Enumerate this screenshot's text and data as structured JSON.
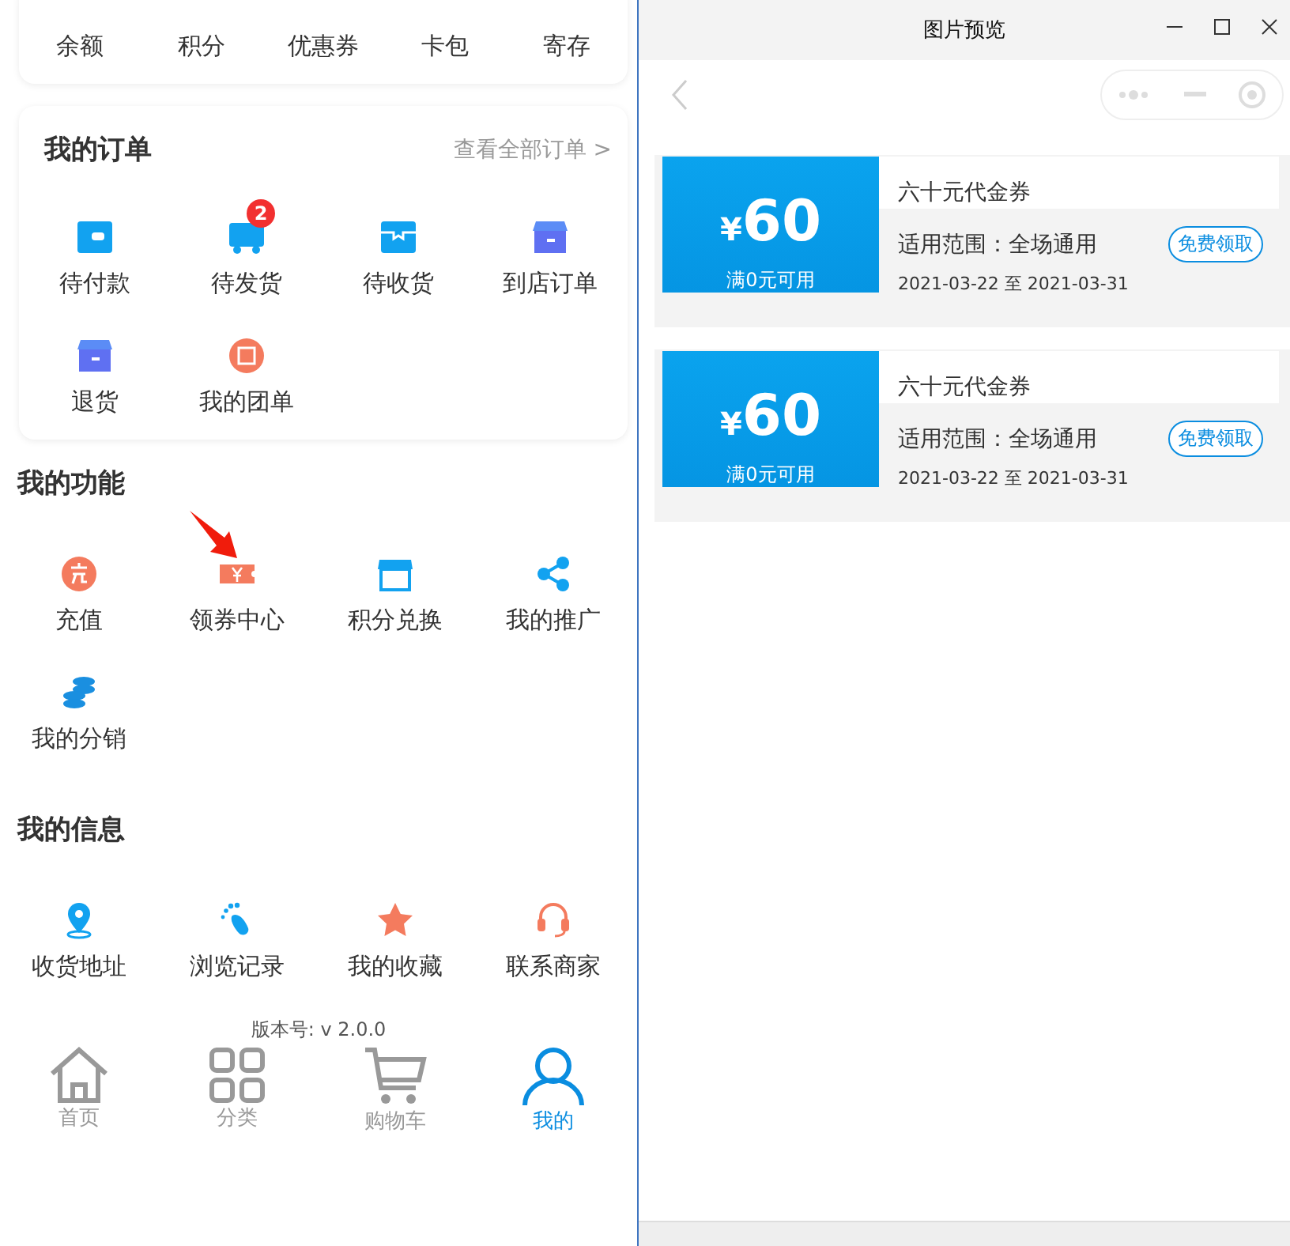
{
  "top_card": {
    "items": [
      "余额",
      "积分",
      "优惠券",
      "卡包",
      "寄存"
    ]
  },
  "orders": {
    "title": "我的订单",
    "view_all": "查看全部订单",
    "chevron": ">",
    "items": [
      {
        "label": "待付款"
      },
      {
        "label": "待发货",
        "badge": "2"
      },
      {
        "label": "待收货"
      },
      {
        "label": "到店订单"
      },
      {
        "label": "退货"
      },
      {
        "label": "我的团单"
      }
    ]
  },
  "functions": {
    "title": "我的功能",
    "items": [
      {
        "label": "充值"
      },
      {
        "label": "领券中心"
      },
      {
        "label": "积分兑换"
      },
      {
        "label": "我的推广"
      },
      {
        "label": "我的分销"
      }
    ]
  },
  "info": {
    "title": "我的信息",
    "items": [
      {
        "label": "收货地址"
      },
      {
        "label": "浏览记录"
      },
      {
        "label": "我的收藏"
      },
      {
        "label": "联系商家"
      }
    ]
  },
  "version": "版本号: v 2.0.0",
  "tab_bar": [
    {
      "label": "首页",
      "selected": false
    },
    {
      "label": "分类",
      "selected": false
    },
    {
      "label": "购物车",
      "selected": false
    },
    {
      "label": "我的",
      "selected": true
    }
  ],
  "preview_window": {
    "title": "图片预览",
    "coupons": [
      {
        "currency": "¥",
        "amount": "60",
        "condition": "满0元可用",
        "name": "六十元代金券",
        "scope": "适用范围：全场通用",
        "dates": "2021-03-22 至 2021-03-31",
        "button": "免费领取"
      },
      {
        "currency": "¥",
        "amount": "60",
        "condition": "满0元可用",
        "name": "六十元代金券",
        "scope": "适用范围：全场通用",
        "dates": "2021-03-22 至 2021-03-31",
        "button": "免费领取"
      }
    ]
  }
}
